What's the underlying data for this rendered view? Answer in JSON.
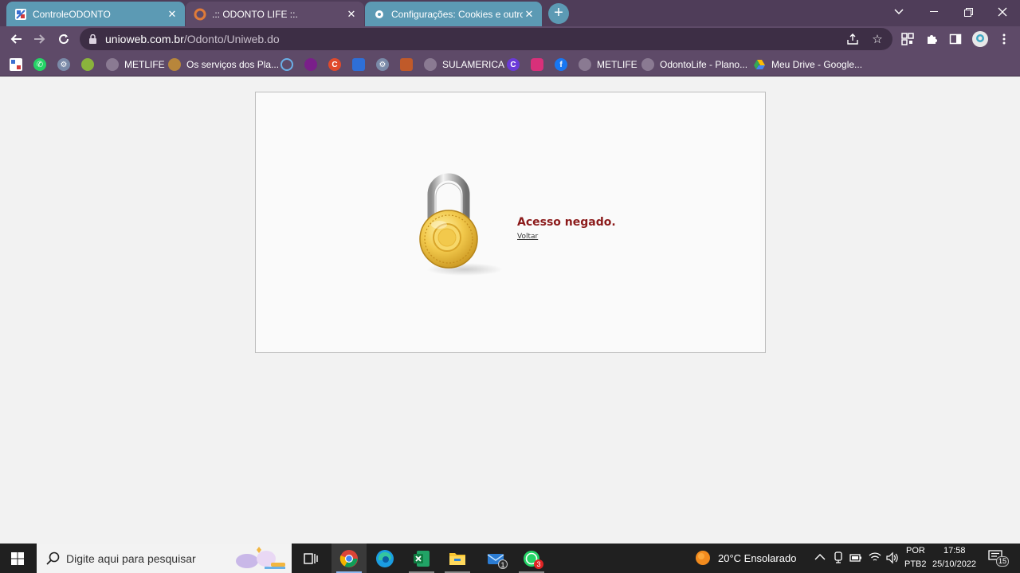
{
  "browser": {
    "tabs": [
      {
        "title": "ControleODONTO",
        "favicon": "controle-odonto-icon"
      },
      {
        "title": ".:: ODONTO LIFE ::.",
        "favicon": "odonto-life-icon"
      },
      {
        "title": "Configurações: Cookies e outros",
        "favicon": "settings-gear-icon"
      }
    ],
    "new_tab_label": "+",
    "url_domain": "unioweb.com.br",
    "url_path": "/Odonto/Uniweb.do",
    "bookmarks": [
      {
        "label": "",
        "icon": "bookmark-icon-1"
      },
      {
        "label": "",
        "icon": "whatsapp-icon"
      },
      {
        "label": "",
        "icon": "gear-icon"
      },
      {
        "label": "",
        "icon": "bookmark-icon-4"
      },
      {
        "label": "METLIFE",
        "icon": "globe-icon"
      },
      {
        "label": "Os serviços dos Pla...",
        "icon": "bookmark-sun-icon"
      },
      {
        "label": "",
        "icon": "search-bookmark-icon"
      },
      {
        "label": "",
        "icon": "bookmark-icon-8"
      },
      {
        "label": "",
        "icon": "bookmark-icon-9"
      },
      {
        "label": "",
        "icon": "bookmark-icon-10"
      },
      {
        "label": "",
        "icon": "gear-icon-2"
      },
      {
        "label": "",
        "icon": "bookmark-icon-12"
      },
      {
        "label": "SULAMERICA",
        "icon": "globe-icon"
      },
      {
        "label": "",
        "icon": "bookmark-c-icon"
      },
      {
        "label": "",
        "icon": "instagram-icon"
      },
      {
        "label": "",
        "icon": "facebook-icon"
      },
      {
        "label": "METLIFE",
        "icon": "globe-icon"
      },
      {
        "label": "OdontoLife - Plano...",
        "icon": "globe-icon"
      },
      {
        "label": "Meu Drive - Google...",
        "icon": "google-drive-icon"
      }
    ]
  },
  "page": {
    "message": "Acesso negado.",
    "back_link": "Voltar"
  },
  "taskbar": {
    "search_placeholder": "Digite aqui para pesquisar",
    "apps": [
      {
        "name": "task-view",
        "badge": ""
      },
      {
        "name": "chrome",
        "badge": ""
      },
      {
        "name": "edge",
        "badge": ""
      },
      {
        "name": "excel",
        "badge": ""
      },
      {
        "name": "file-explorer",
        "badge": ""
      },
      {
        "name": "mail",
        "badge": "1"
      },
      {
        "name": "whatsapp",
        "badge": "3"
      }
    ],
    "weather": "20°C  Ensolarado",
    "lang_top": "POR",
    "lang_bottom": "PTB2",
    "time": "17:58",
    "date": "25/10/2022",
    "notifications": "15"
  },
  "colors": {
    "frame": "#4f3d59",
    "toolbar": "#5e4a68",
    "tab_blue": "#5c9ab4",
    "denied_text": "#8b1a1a"
  }
}
